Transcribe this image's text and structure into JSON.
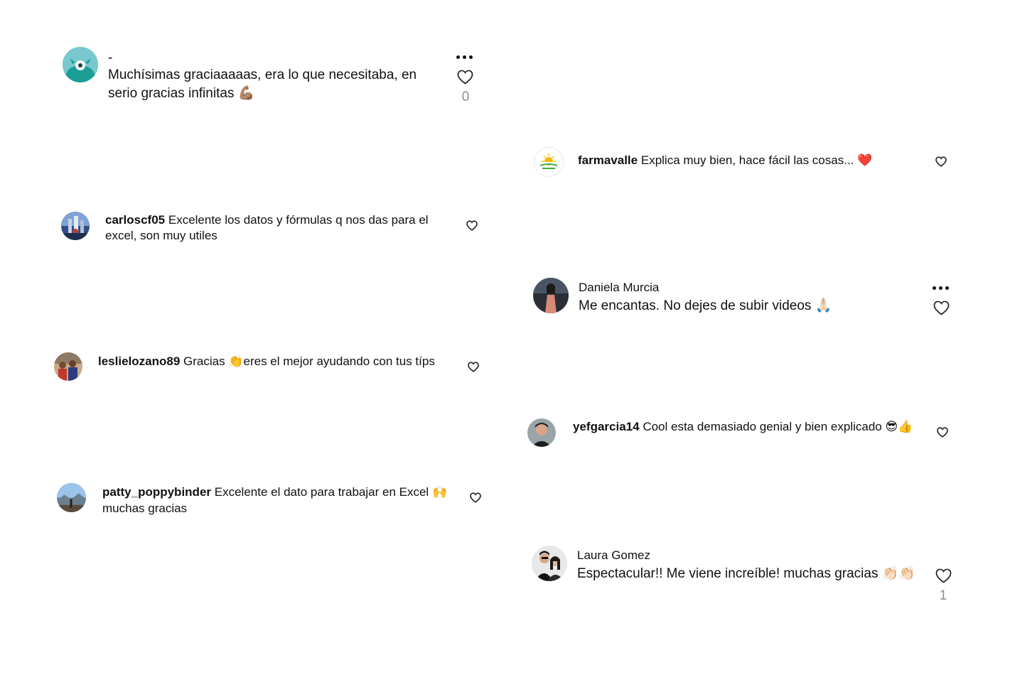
{
  "comments": [
    {
      "id": "c1",
      "author": "-",
      "text": "Muchísimas graciaaaaas, era lo que necesitaba, en serio gracias infinitas",
      "emoji": "💪🏽",
      "likes": "0",
      "avatar_icon": "teal-monster-avatar"
    },
    {
      "id": "c2",
      "username": "farmavalle",
      "text": "Explica muy bien, hace fácil las cosas...",
      "emoji": "❤️",
      "avatar_icon": "farmavalle-sun-logo"
    },
    {
      "id": "c3",
      "username": "carloscf05",
      "text": "Excelente los datos y fórmulas q nos das para el excel, son muy utiles",
      "avatar_icon": "city-photo-avatar"
    },
    {
      "id": "c4",
      "author": "Daniela Murcia",
      "text": "Me encantas. No dejes de subir videos",
      "emoji": "🙏🏻",
      "avatar_icon": "person-photo-avatar"
    },
    {
      "id": "c5",
      "username": "leslielozano89",
      "text_before": "Gracias",
      "emoji": "👏",
      "text": "eres el mejor ayudando con tus típs",
      "avatar_icon": "family-photo-avatar"
    },
    {
      "id": "c6",
      "username": "yefgarcia14",
      "text": "Cool esta demasiado genial y bien explicado",
      "emoji": "😎👍",
      "avatar_icon": "man-photo-avatar"
    },
    {
      "id": "c7",
      "username": "patty_poppybinder",
      "text": "Excelente el dato para trabajar en Excel",
      "emoji": "🙌",
      "text_after": "muchas gracias",
      "avatar_icon": "landscape-photo-avatar"
    },
    {
      "id": "c8",
      "author": "Laura Gomez",
      "text": "Espectacular!! Me viene increíble! muchas gracias",
      "emoji": "👏🏻👏🏻",
      "likes": "1",
      "avatar_icon": "couple-photo-avatar"
    }
  ],
  "colors": {
    "text": "#111111",
    "muted": "#8e8e8e",
    "teal": "#1fa89d",
    "heart_red": "#e0245e"
  }
}
